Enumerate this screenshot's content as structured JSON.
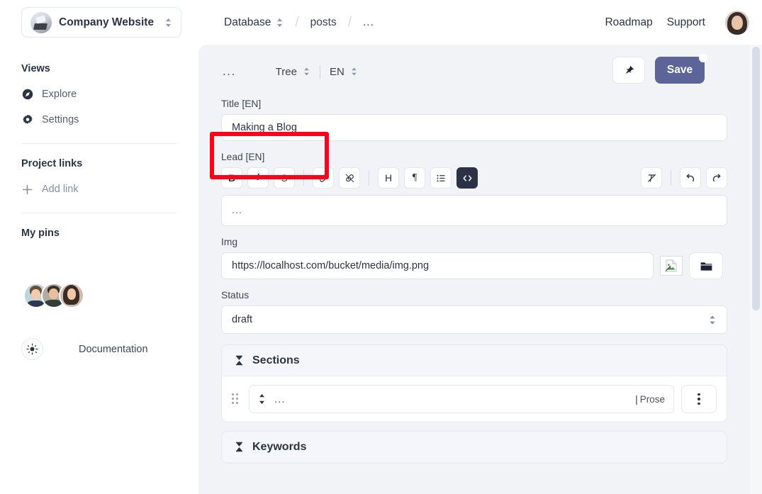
{
  "topbar": {
    "project_name": "Company Website",
    "project_avatar_icon": "workspace-photo",
    "breadcrumb": {
      "root": "Database",
      "middle": "posts",
      "current": "..."
    },
    "nav": [
      {
        "label": "Roadmap",
        "name": "roadmap-link"
      },
      {
        "label": "Support",
        "name": "support-link"
      }
    ],
    "user_avatar_icon": "user-avatar"
  },
  "sidebar": {
    "views_heading": "Views",
    "views": [
      {
        "label": "Explore",
        "icon": "compass-icon"
      },
      {
        "label": "Settings",
        "icon": "gear-icon"
      }
    ],
    "project_links_heading": "Project links",
    "add_link_label": "Add link",
    "add_link_icon": "plus-icon",
    "my_pins_heading": "My pins",
    "documentation_label": "Documentation",
    "documentation_icon": "sun-icon"
  },
  "editor": {
    "more_menu": "...",
    "view_mode": "Tree",
    "language": "EN",
    "pin_icon": "pushpin-icon",
    "save_label": "Save",
    "save_badge": "unsaved-changes-dot",
    "accent_color": "#5d6497",
    "annotation_color": "#fb0318"
  },
  "form": {
    "title": {
      "label": "Title [EN]",
      "value": "Making a Blog"
    },
    "lead": {
      "label": "Lead [EN]",
      "body_value": "...",
      "toolbar": [
        {
          "name": "bold-button",
          "glyph": "B",
          "active": false
        },
        {
          "name": "italic-button",
          "glyph": "I",
          "active": false
        },
        {
          "name": "strikethrough-button",
          "glyph": "S",
          "active": false
        },
        {
          "name": "link-button",
          "glyph": "link-icon",
          "active": false
        },
        {
          "name": "unlink-button",
          "glyph": "unlink-icon",
          "active": false
        },
        {
          "name": "heading-button",
          "glyph": "H",
          "active": false
        },
        {
          "name": "paragraph-button",
          "glyph": "¶",
          "active": false
        },
        {
          "name": "bullet-list-button",
          "glyph": "list-icon",
          "active": false
        },
        {
          "name": "code-block-button",
          "glyph": "</>",
          "active": true
        }
      ],
      "toolbar_right": [
        {
          "name": "clear-formatting-button",
          "glyph": "clear-format-icon"
        },
        {
          "name": "undo-button",
          "glyph": "undo-icon"
        },
        {
          "name": "redo-button",
          "glyph": "redo-icon"
        }
      ]
    },
    "img": {
      "label": "Img",
      "value": "https://localhost.com/bucket/media/img.png",
      "thumbnail_icon": "broken-image-icon",
      "browse_icon": "folder-icon"
    },
    "status": {
      "label": "Status",
      "value": "draft"
    }
  },
  "sections_group": {
    "title": "Sections",
    "collapse_icon": "collapse-icon",
    "row": {
      "drag_handle": "drag-handle-icon",
      "reorder_icon": "up-down-arrows-icon",
      "value": "...",
      "type_label": "Prose",
      "menu_icon": "kebab-menu-icon"
    }
  },
  "keywords_group": {
    "title": "Keywords",
    "collapse_icon": "collapse-icon"
  }
}
